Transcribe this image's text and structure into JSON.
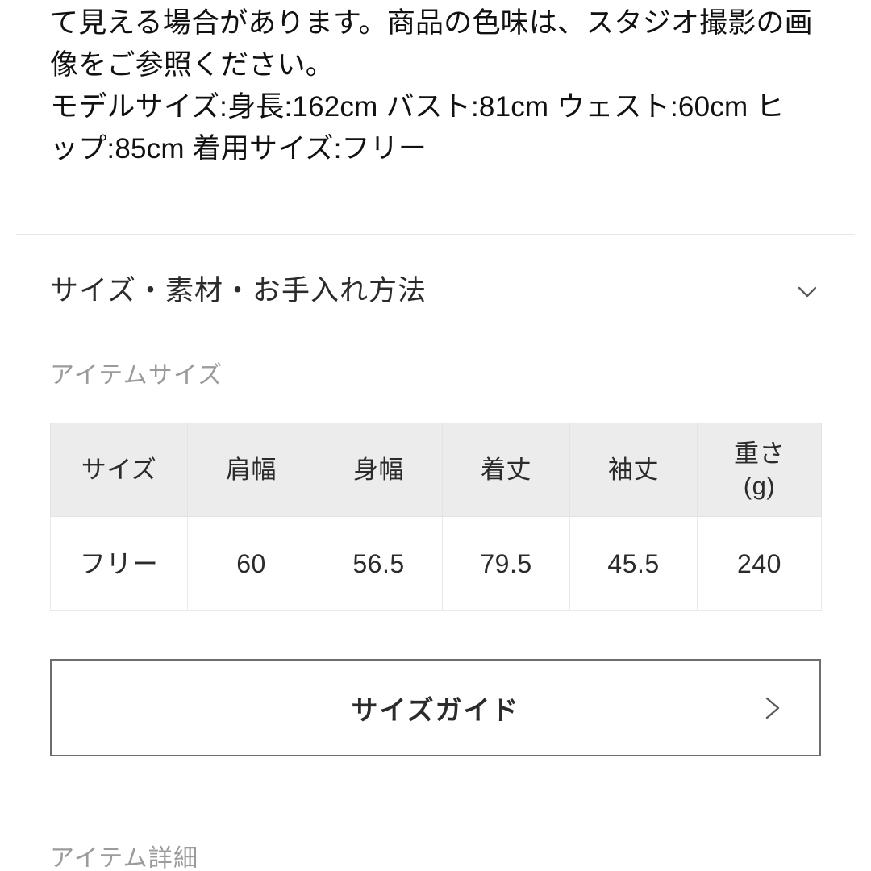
{
  "description": {
    "lines": [
      "て見える場合があります。商品の色味は、スタジオ撮影の画",
      "像をご参照ください。",
      "モデルサイズ:身長:162cm バスト:81cm ウェスト:60cm ヒ",
      "ップ:85cm 着用サイズ:フリー"
    ]
  },
  "accordion": {
    "title": "サイズ・素材・お手入れ方法",
    "toggle_icon": "chevron-down-icon"
  },
  "item_size": {
    "label": "アイテムサイズ",
    "table": {
      "headers": [
        "サイズ",
        "肩幅",
        "身幅",
        "着丈",
        "袖丈",
        "重さ"
      ],
      "header_weight_unit": "(g)",
      "rows": [
        [
          "フリー",
          "60",
          "56.5",
          "79.5",
          "45.5",
          "240"
        ]
      ]
    }
  },
  "size_guide": {
    "label": "サイズガイド",
    "arrow_icon": "chevron-right-icon"
  },
  "item_detail": {
    "label": "アイテム詳細"
  },
  "colors": {
    "text_primary": "#2b2b2b",
    "text_body": "#111111",
    "text_muted": "#9b9b9b",
    "divider": "#e6e7e8",
    "table_header_bg": "#ececec",
    "table_border": "#e3e3e3",
    "button_border": "#6d6d6d",
    "background": "#ffffff"
  }
}
